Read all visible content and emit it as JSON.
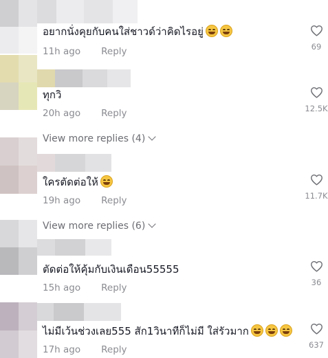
{
  "comments": [
    {
      "text": "อยากนั่งคุยกับคนใส่ชาวด์ว่าคิดไรอยู่",
      "emoji_count": 2,
      "time": "11h ago",
      "reply_label": "Reply",
      "likes": "69"
    },
    {
      "text": "ทุกวิ",
      "emoji_count": 0,
      "time": "20h ago",
      "reply_label": "Reply",
      "likes": "12.5K",
      "view_more": "View more replies (4)"
    },
    {
      "text": "ใครตัดต่อให้",
      "emoji_count": 1,
      "time": "19h ago",
      "reply_label": "Reply",
      "likes": "11.7K",
      "view_more": "View more replies (6)"
    },
    {
      "text": "ตัดต่อให้คุ้มกับเงินเดือน55555",
      "emoji_count": 0,
      "time": "15h ago",
      "reply_label": "Reply",
      "likes": "36"
    },
    {
      "text": "ไม่มีเว้นช่วงเลย555 สัก1วินาทีก็ไม่มี ใส่รัวมาก",
      "emoji_count": 3,
      "time": "17h ago",
      "reply_label": "Reply",
      "likes": "637"
    }
  ],
  "icons": {
    "like": "heart-outline-icon",
    "emoji": "grinning-squinting-face-icon",
    "expand": "chevron-down-icon"
  },
  "colors": {
    "text": "#161823",
    "meta": "#8a8b91",
    "view_more": "#6c6d73",
    "background": "#ffffff"
  }
}
